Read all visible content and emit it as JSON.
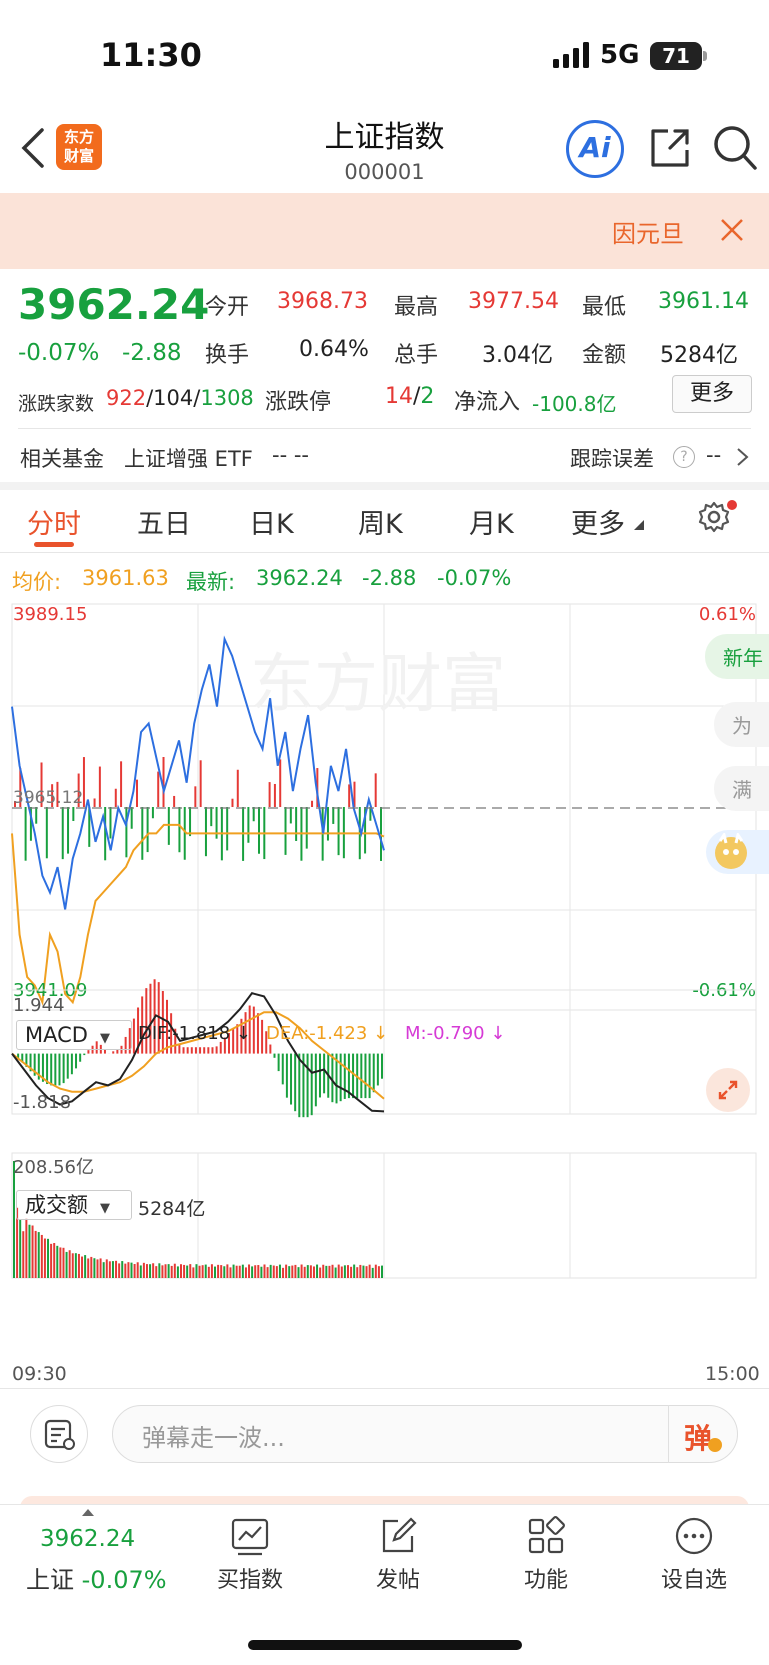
{
  "status_bar": {
    "time": "11:30",
    "network": "5G",
    "battery": "71"
  },
  "header": {
    "title": "上证指数",
    "code": "000001",
    "logo_text": "东方财富",
    "ai_label": "Ai"
  },
  "notice": {
    "text": "因元旦"
  },
  "quote": {
    "price": "3962.24",
    "change_pct": "-0.07%",
    "change": "-2.88",
    "open_label": "今开",
    "open": "3968.73",
    "high_label": "最高",
    "high": "3977.54",
    "low_label": "最低",
    "low": "3961.14",
    "turnover_rate_label": "换手",
    "turnover_rate": "0.64%",
    "volume_label": "总手",
    "volume": "3.04亿",
    "amount_label": "金额",
    "amount": "5284亿",
    "breadth_label": "涨跌家数",
    "up_count": "922",
    "flat_count": "104",
    "down_count": "1308",
    "limit_label": "涨跌停",
    "limit_up": "14",
    "limit_down": "2",
    "inflow_label": "净流入",
    "inflow": "-100.8亿",
    "more_label": "更多"
  },
  "fund": {
    "label": "相关基金",
    "name": "上证增强 ETF",
    "value": "-- --",
    "tracking_label": "跟踪误差",
    "tracking_value": "--"
  },
  "tabs": [
    {
      "label": "分时",
      "active": true
    },
    {
      "label": "五日"
    },
    {
      "label": "日K"
    },
    {
      "label": "周K"
    },
    {
      "label": "月K"
    },
    {
      "label": "更多"
    }
  ],
  "intraday": {
    "avg_label": "均价:",
    "avg_value": "3961.63",
    "latest_label": "最新:",
    "latest_value": "3962.24",
    "latest_change": "-2.88",
    "latest_pct": "-0.07%",
    "y_max": "3989.15",
    "y_min": "3941.09",
    "prev_close": "3965.12",
    "pct_max": "0.61%",
    "pct_min": "-0.61%",
    "watermark": "东方财富",
    "side_pills": [
      "新年",
      "为",
      "满"
    ],
    "start_time": "09:30",
    "end_time": "15:00"
  },
  "macd": {
    "selector": "MACD",
    "dif": "DIF:-1.818 ↓",
    "dea": "DEA:-1.423 ↓",
    "m": "M:-0.790 ↓",
    "y_max": "1.944",
    "y_min": "-1.818"
  },
  "volume_panel": {
    "selector": "成交额",
    "total": "5284亿",
    "y_max": "208.56亿"
  },
  "danmaku": {
    "placeholder": "弹幕走一波...",
    "send_label": "弹"
  },
  "bottom_nav": {
    "price": "3962.24",
    "index_name": "上证",
    "index_pct": "-0.07%",
    "items": [
      "买指数",
      "发帖",
      "功能",
      "设自选"
    ]
  },
  "colors": {
    "up": "#e53935",
    "down": "#18a03e",
    "price_line": "#2d6fe0",
    "avg_line": "#f0a020",
    "accent": "#e9532c"
  },
  "chart_data": {
    "type": "line",
    "x_range": [
      "09:30",
      "15:00"
    ],
    "ylim": [
      3941.09,
      3989.15
    ],
    "prev_close": 3965.12,
    "price_series": [
      3977,
      3970,
      3966,
      3962,
      3957,
      3955,
      3958,
      3953,
      3959,
      3962,
      3966,
      3961,
      3964,
      3960,
      3965,
      3963,
      3967,
      3974,
      3975,
      3971,
      3967,
      3970,
      3973,
      3968,
      3975,
      3979,
      3982,
      3977,
      3985,
      3983,
      3980,
      3977,
      3974,
      3972,
      3978,
      3970,
      3974,
      3967,
      3972,
      3976,
      3968,
      3962,
      3970,
      3967,
      3972,
      3965,
      3962,
      3966,
      3963,
      3960
    ],
    "avg_series": [
      3962,
      3950,
      3945,
      3944,
      3942,
      3950,
      3948,
      3943,
      3942,
      3945,
      3950,
      3954,
      3955,
      3956,
      3957,
      3958,
      3960,
      3961,
      3962,
      3962,
      3963,
      3963,
      3963,
      3962,
      3962,
      3962,
      3962,
      3962,
      3962,
      3962,
      3962,
      3962,
      3962,
      3962,
      3962,
      3962,
      3962,
      3962,
      3962,
      3962,
      3962,
      3962,
      3962,
      3962,
      3962,
      3962,
      3962,
      3962,
      3962,
      3961.63
    ],
    "macd_dif": [
      0.0,
      -0.5,
      -1.0,
      -1.4,
      -1.6,
      -1.5,
      -1.2,
      -0.9,
      -1.0,
      -0.8,
      -0.2,
      0.6,
      1.2,
      1.0,
      0.4,
      0.5,
      0.6,
      0.7,
      1.0,
      1.4,
      1.9,
      1.8,
      1.2,
      0.4,
      -0.2,
      -0.6,
      -0.5,
      -1.0,
      -1.2,
      -1.5,
      -1.8,
      -1.818
    ],
    "macd_dea": [
      0.0,
      -0.3,
      -0.6,
      -0.9,
      -1.1,
      -1.2,
      -1.2,
      -1.1,
      -1.0,
      -0.9,
      -0.7,
      -0.4,
      0.0,
      0.2,
      0.3,
      0.4,
      0.5,
      0.6,
      0.7,
      0.9,
      1.1,
      1.3,
      1.3,
      1.1,
      0.8,
      0.4,
      0.1,
      -0.2,
      -0.5,
      -0.8,
      -1.1,
      -1.423
    ],
    "volume_max": 208.56
  }
}
